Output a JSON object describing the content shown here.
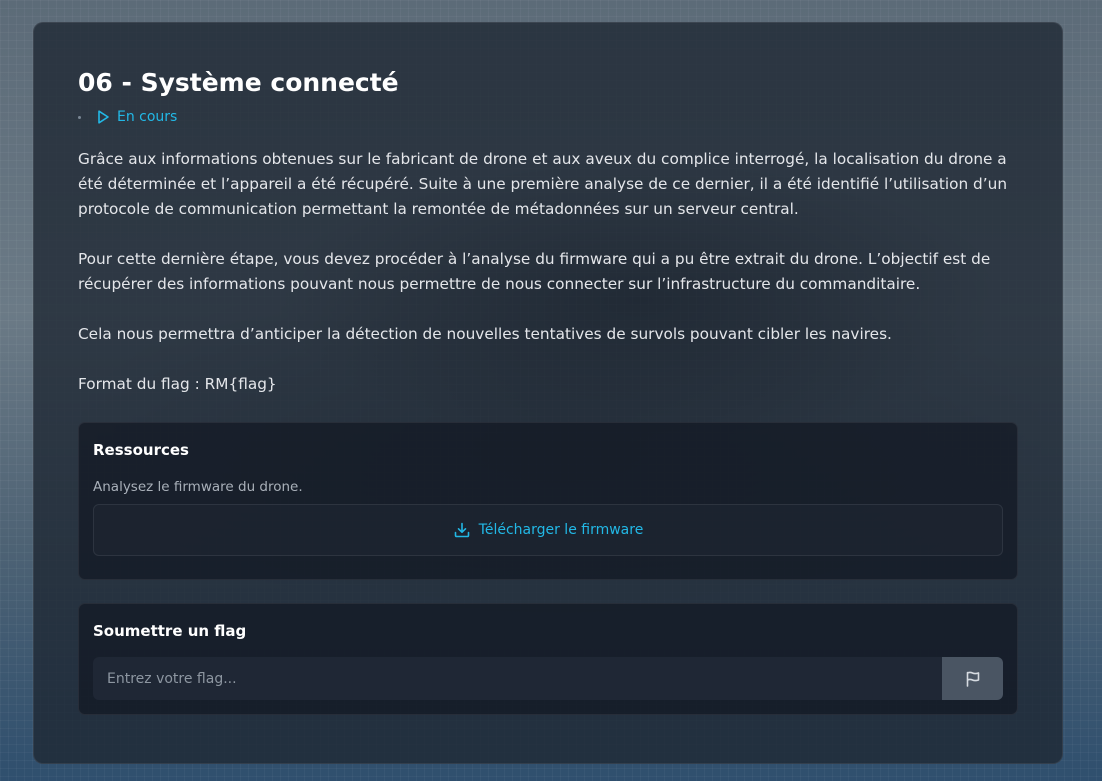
{
  "challenge": {
    "title": "06 - Système connecté",
    "status": "En cours",
    "accent_color": "#22b8e6",
    "status_icon": "play-icon",
    "description": [
      "Grâce aux informations obtenues sur le fabricant de drone et aux aveux du complice interrogé, la localisation du drone a été déterminée et l’appareil a été récupéré. Suite à une première analyse de ce dernier, il a été identifié l’utilisation d’un protocole de communication permettant la remontée de métadonnées sur un serveur central.",
      "Pour cette dernière étape, vous devez procéder à l’analyse du firmware qui a pu être extrait du drone. L’objectif est de récupérer des informations pouvant nous permettre de nous connecter sur l’infrastructure du commanditaire.",
      "Cela nous permettra d’anticiper la détection de nouvelles tentatives de survols pouvant cibler les navires.",
      "Format du flag : RM{flag}"
    ]
  },
  "resources": {
    "title": "Ressources",
    "subtitle": "Analysez le firmware du drone.",
    "download_label": "Télécharger le firmware",
    "download_icon": "download-icon"
  },
  "submit": {
    "title": "Soumettre un flag",
    "placeholder": "Entrez votre flag...",
    "value": "",
    "button_icon": "flag-icon",
    "button_color": "#4a5563"
  }
}
